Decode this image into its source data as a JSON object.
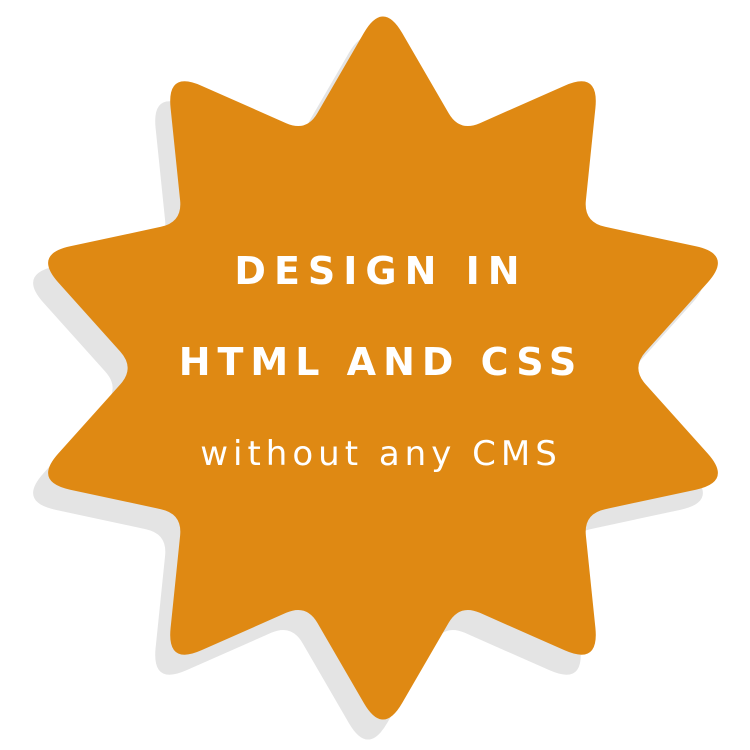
{
  "badge": {
    "shape": "ten-point-star-burst",
    "fill_color": "#DF8913",
    "shadow_color": "#E4E4E4",
    "text_color": "#FFFFFF",
    "lines": [
      "DESIGN IN",
      "HTML AND CSS",
      "without any CMS"
    ]
  }
}
